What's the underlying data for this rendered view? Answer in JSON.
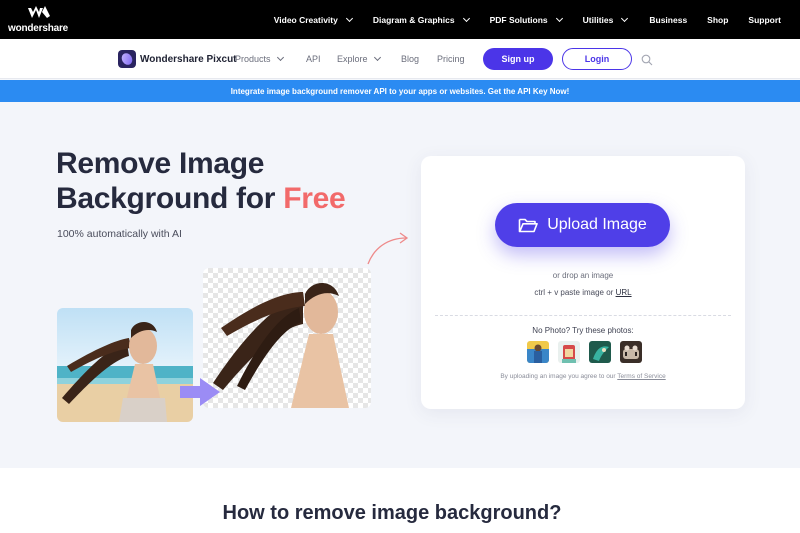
{
  "topbar": {
    "brand": "wondershare",
    "menu": [
      {
        "label": "Video Creativity",
        "dropdown": true
      },
      {
        "label": "Diagram & Graphics",
        "dropdown": true
      },
      {
        "label": "PDF Solutions",
        "dropdown": true
      },
      {
        "label": "Utilities",
        "dropdown": true
      },
      {
        "label": "Business",
        "dropdown": false
      },
      {
        "label": "Shop",
        "dropdown": false
      },
      {
        "label": "Support",
        "dropdown": false
      }
    ]
  },
  "navbar": {
    "brand_name": "Wondershare Pixcut",
    "items": [
      {
        "label": "Products",
        "dropdown": true
      },
      {
        "label": "API",
        "dropdown": false
      },
      {
        "label": "Explore",
        "dropdown": true
      },
      {
        "label": "Blog",
        "dropdown": false
      },
      {
        "label": "Pricing",
        "dropdown": false
      }
    ],
    "signup_label": "Sign up",
    "login_label": "Login",
    "search_icon": "search-icon"
  },
  "banner": {
    "text": "Integrate image background remover API to your apps or websites. Get the API Key Now!"
  },
  "hero": {
    "title_line1": "Remove Image",
    "title_line2_prefix": "Background for ",
    "title_highlight": "Free",
    "subtitle": "100% automatically with AI"
  },
  "upload": {
    "button_label": "Upload Image",
    "button_icon": "folder-icon",
    "drop_text": "or drop an image",
    "paste_prefix": "ctrl + v paste image or ",
    "paste_link": "URL",
    "sample_heading": "No Photo? Try these photos:",
    "terms_prefix": "By uploading an image you agree to our ",
    "terms_link": "Terms of Service"
  },
  "section": {
    "how_title": "How to remove image background?"
  },
  "colors": {
    "accent": "#4f3fe8",
    "banner": "#2b8bf2",
    "highlight": "#f26a6a"
  }
}
